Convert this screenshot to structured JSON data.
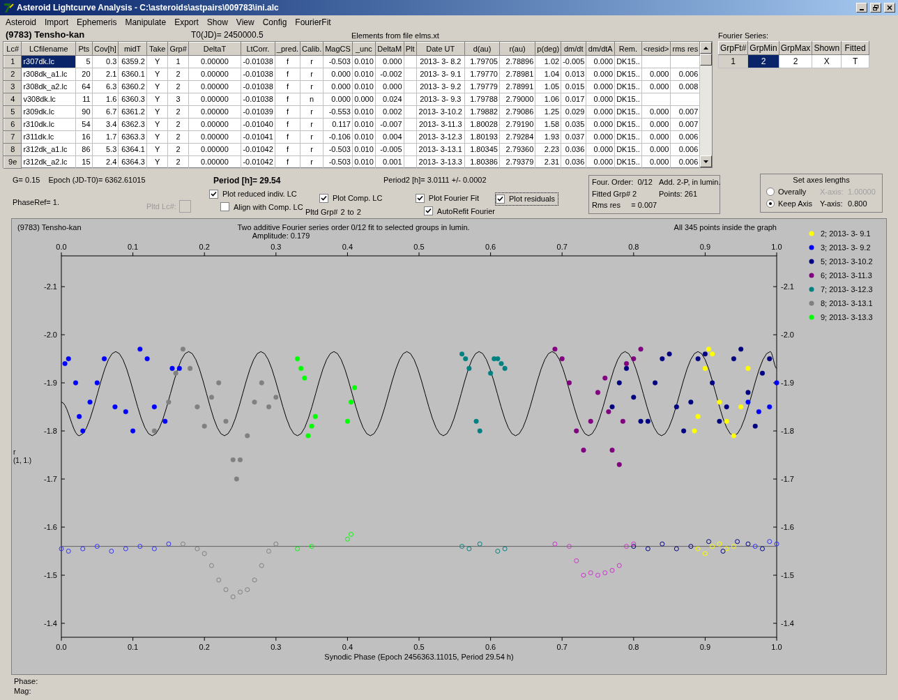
{
  "window": {
    "title": "Asteroid Lightcurve Analysis - C:\\asteroids\\astpairs\\009783\\ini.alc"
  },
  "menu": [
    "Asteroid",
    "Import",
    "Ephemeris",
    "Manipulate",
    "Export",
    "Show",
    "View",
    "Config",
    "FourierFit"
  ],
  "header": {
    "object": "(9783) Tensho-kan",
    "t0": "T0(JD)= 2450000.5",
    "elements": "Elements from file elms.xt"
  },
  "table": {
    "columns": [
      "Lc#",
      "LCfilename",
      "Pts",
      "Cov[h]",
      "midT",
      "Take",
      "Grp#",
      "DeltaT",
      "LtCorr.",
      "_pred.",
      "Calib.",
      "MagCS",
      "_unc",
      "DeltaM",
      "Plt",
      "Date UT",
      "d(au)",
      "r(au)",
      "p(deg)",
      "dm/dt",
      "dm/dtA",
      "Rem.",
      "<resid>",
      "rms res"
    ],
    "rows": [
      {
        "selected": true,
        "cells": [
          "1",
          "r307dk.lc",
          "5",
          "0.3",
          "6359.2",
          "Y",
          "1",
          "0.00000",
          "-0.01038",
          "f",
          "r",
          "-0.503",
          "0.010",
          "0.000",
          null,
          "2013- 3- 8.2",
          "1.79705",
          "2.78896",
          "1.02",
          "-0.005",
          "0.000",
          "DK15..",
          null,
          null
        ]
      },
      {
        "selected": false,
        "cells": [
          "2",
          "r308dk_a1.lc",
          "20",
          "2.1",
          "6360.1",
          "Y",
          "2",
          "0.00000",
          "-0.01038",
          "f",
          "r",
          "0.000",
          "0.010",
          "-0.002",
          null,
          "2013- 3- 9.1",
          "1.79770",
          "2.78981",
          "1.04",
          "0.013",
          "0.000",
          "DK15..",
          "0.000",
          "0.006"
        ]
      },
      {
        "selected": false,
        "cells": [
          "3",
          "r308dk_a2.lc",
          "64",
          "6.3",
          "6360.2",
          "Y",
          "2",
          "0.00000",
          "-0.01038",
          "f",
          "r",
          "0.000",
          "0.010",
          "0.000",
          null,
          "2013- 3- 9.2",
          "1.79779",
          "2.78991",
          "1.05",
          "0.015",
          "0.000",
          "DK15..",
          "0.000",
          "0.008"
        ]
      },
      {
        "selected": false,
        "cells": [
          "4",
          "v308dk.lc",
          "11",
          "1.6",
          "6360.3",
          "Y",
          "3",
          "0.00000",
          "-0.01038",
          "f",
          "n",
          "0.000",
          "0.000",
          "0.024",
          null,
          "2013- 3- 9.3",
          "1.79788",
          "2.79000",
          "1.06",
          "0.017",
          "0.000",
          "DK15..",
          null,
          null
        ]
      },
      {
        "selected": false,
        "cells": [
          "5",
          "r309dk.lc",
          "90",
          "6.7",
          "6361.2",
          "Y",
          "2",
          "0.00000",
          "-0.01039",
          "f",
          "r",
          "-0.553",
          "0.010",
          "0.002",
          null,
          "2013- 3-10.2",
          "1.79882",
          "2.79086",
          "1.25",
          "0.029",
          "0.000",
          "DK15..",
          "0.000",
          "0.007"
        ]
      },
      {
        "selected": false,
        "cells": [
          "6",
          "r310dk.lc",
          "54",
          "3.4",
          "6362.3",
          "Y",
          "2",
          "0.00000",
          "-0.01040",
          "f",
          "r",
          "0.117",
          "0.010",
          "-0.007",
          null,
          "2013- 3-11.3",
          "1.80028",
          "2.79190",
          "1.58",
          "0.035",
          "0.000",
          "DK15..",
          "0.000",
          "0.007"
        ]
      },
      {
        "selected": false,
        "cells": [
          "7",
          "r311dk.lc",
          "16",
          "1.7",
          "6363.3",
          "Y",
          "2",
          "0.00000",
          "-0.01041",
          "f",
          "r",
          "-0.106",
          "0.010",
          "0.004",
          null,
          "2013- 3-12.3",
          "1.80193",
          "2.79284",
          "1.93",
          "0.037",
          "0.000",
          "DK15..",
          "0.000",
          "0.006"
        ]
      },
      {
        "selected": false,
        "cells": [
          "8",
          "r312dk_a1.lc",
          "86",
          "5.3",
          "6364.1",
          "Y",
          "2",
          "0.00000",
          "-0.01042",
          "f",
          "r",
          "-0.503",
          "0.010",
          "-0.005",
          null,
          "2013- 3-13.1",
          "1.80345",
          "2.79360",
          "2.23",
          "0.036",
          "0.000",
          "DK15..",
          "0.000",
          "0.006"
        ]
      },
      {
        "selected": false,
        "cells": [
          "9e",
          "r312dk_a2.lc",
          "15",
          "2.4",
          "6364.3",
          "Y",
          "2",
          "0.00000",
          "-0.01042",
          "f",
          "r",
          "-0.503",
          "0.010",
          "0.001",
          null,
          "2013- 3-13.3",
          "1.80386",
          "2.79379",
          "2.31",
          "0.036",
          "0.000",
          "DK15..",
          "0.000",
          "0.006"
        ]
      }
    ]
  },
  "fourier": {
    "label": "Fourier Series:",
    "columns": [
      "GrpFt#",
      "GrpMin",
      "GrpMax",
      "Shown",
      "Fitted"
    ],
    "rows": [
      {
        "cells": [
          {
            "text": "1",
            "selected": false
          },
          {
            "text": "2",
            "selected": true
          },
          {
            "text": "2",
            "selected": false
          },
          {
            "text": "X",
            "selected": false
          },
          {
            "text": "T",
            "selected": false
          }
        ]
      }
    ]
  },
  "summary": {
    "g": "G= 0.15",
    "epoch": "Epoch (JD-T0)= 6362.61015",
    "period": "Period [h]= 29.54",
    "period2": "Period2 [h]= 3.0111 +/- 0.0002",
    "phaseref": "PhaseRef= 1."
  },
  "pltd_lc": {
    "label": "Pltd Lc#:",
    "disabled": true
  },
  "checkboxes": {
    "plot_reduced": {
      "label": "Plot reduced indiv. LC",
      "checked": true
    },
    "align": {
      "label": "Align with Comp. LC",
      "checked": false
    },
    "plot_comp": {
      "label": "Plot Comp. LC",
      "checked": true
    },
    "plot_fourier": {
      "label": "Plot Fourier Fit",
      "checked": true
    },
    "autorefit": {
      "label": "AutoRefit Fourier",
      "checked": true
    },
    "plot_residuals": {
      "label": "Plot residuals",
      "checked": true
    }
  },
  "pltd_grp": {
    "label": "Pltd Grp#",
    "from": "2",
    "to_label": "to",
    "to": "2"
  },
  "fit_info": [
    "Four. Order:  0/12",
    "Add. 2-P, in lumin.",
    "Fitted Grp# 2",
    "Points: 261",
    "Rms res     = 0.007"
  ],
  "axes": {
    "title": "Set axes lengths",
    "options": [
      {
        "label": "Overally",
        "selected": false
      },
      {
        "label": "Keep Axis",
        "selected": true
      }
    ],
    "x_label": "X-axis:",
    "x_value": "1.00000",
    "x_disabled": true,
    "y_label": "Y-axis:",
    "y_value": "0.800",
    "y_disabled": false
  },
  "plot": {
    "object": "(9783) Tensho-kan",
    "subtitle": "Two additive Fourier series order 0/12 fit to selected groups in lumin.",
    "amplitude": "Amplitude: 0.179",
    "note": "All 345 points inside the graph",
    "chart_data": {
      "type": "scatter",
      "xlabel": "Synodic Phase (Epoch 2456363.11015, Period 29.54 h)",
      "ylabel": [
        "r",
        "(1, 1.)"
      ],
      "xlim": [
        0,
        1
      ],
      "ylim": [
        -1.371,
        -2.164
      ],
      "xticks": [
        {
          "value": 0,
          "label": "0.0"
        },
        {
          "value": 0.1,
          "label": "0.1"
        },
        {
          "value": 0.2,
          "label": "0.2"
        },
        {
          "value": 0.3,
          "label": "0.3"
        },
        {
          "value": 0.4,
          "label": "0.4"
        },
        {
          "value": 0.5,
          "label": "0.5"
        },
        {
          "value": 0.6,
          "label": "0.6"
        },
        {
          "value": 0.7,
          "label": "0.7"
        },
        {
          "value": 0.8,
          "label": "0.8"
        },
        {
          "value": 0.9,
          "label": "0.9"
        },
        {
          "value": 1,
          "label": "1.0"
        }
      ],
      "yticks": [
        {
          "value": -2.1,
          "label": "-2.1"
        },
        {
          "value": -2.0,
          "label": "-2.0"
        },
        {
          "value": -1.9,
          "label": "-1.9"
        },
        {
          "value": -1.8,
          "label": "-1.8"
        },
        {
          "value": -1.7,
          "label": "-1.7"
        },
        {
          "value": -1.6,
          "label": "-1.6"
        },
        {
          "value": -1.5,
          "label": "-1.5"
        },
        {
          "value": -1.4,
          "label": "-1.4"
        }
      ],
      "ref_lines": [
        {
          "axis": "y",
          "value": -1.56,
          "color": "#606060"
        }
      ],
      "legend": true,
      "series": [
        {
          "type": "line",
          "color": "#000000",
          "x": [
            0,
            0.025,
            0.076,
            0.127,
            0.178,
            0.228,
            0.279,
            0.33,
            0.381,
            0.432,
            0.483,
            0.534,
            0.584,
            0.635,
            0.686,
            0.737,
            0.788,
            0.839,
            0.89,
            0.94,
            0.991,
            1.0
          ],
          "values": [
            -1.86,
            -1.79,
            -1.965,
            -1.79,
            -1.965,
            -1.79,
            -1.965,
            -1.79,
            -1.965,
            -1.79,
            -1.965,
            -1.79,
            -1.965,
            -1.79,
            -1.965,
            -1.79,
            -1.965,
            -1.79,
            -1.965,
            -1.79,
            -1.965,
            -1.93
          ]
        },
        {
          "name": "2; 2013- 3- 9.1",
          "color": "#ffff00",
          "marker": "circle",
          "x": [
            0.885,
            0.89,
            0.9,
            0.905,
            0.91,
            0.92,
            0.93,
            0.94,
            0.95,
            0.96
          ],
          "values": [
            -1.8,
            -1.83,
            -1.93,
            -1.97,
            -1.96,
            -1.86,
            -1.82,
            -1.79,
            -1.85,
            -1.93
          ]
        },
        {
          "name": "3; 2013- 3- 9.2",
          "color": "#0000ff",
          "marker": "circle",
          "x": [
            0.005,
            0.01,
            0.02,
            0.025,
            0.03,
            0.04,
            0.05,
            0.06,
            0.075,
            0.09,
            0.1,
            0.11,
            0.12,
            0.13,
            0.145,
            0.155,
            0.165,
            0.96,
            0.975,
            0.99,
            1.0
          ],
          "values": [
            -1.94,
            -1.95,
            -1.9,
            -1.83,
            -1.8,
            -1.86,
            -1.9,
            -1.95,
            -1.85,
            -1.84,
            -1.8,
            -1.97,
            -1.95,
            -1.85,
            -1.82,
            -1.93,
            -1.93,
            -1.86,
            -1.84,
            -1.85,
            -1.9
          ]
        },
        {
          "name": "5; 2013- 3-10.2",
          "color": "#000080",
          "marker": "circle",
          "x": [
            0.77,
            0.78,
            0.79,
            0.8,
            0.81,
            0.82,
            0.83,
            0.84,
            0.85,
            0.86,
            0.87,
            0.88,
            0.89,
            0.9,
            0.91,
            0.92,
            0.93,
            0.94,
            0.95,
            0.96,
            0.97,
            0.98,
            0.99
          ],
          "values": [
            -1.85,
            -1.9,
            -1.93,
            -1.87,
            -1.82,
            -1.82,
            -1.9,
            -1.95,
            -1.96,
            -1.85,
            -1.8,
            -1.86,
            -1.95,
            -1.96,
            -1.9,
            -1.82,
            -1.85,
            -1.95,
            -1.97,
            -1.88,
            -1.81,
            -1.92,
            -1.95
          ]
        },
        {
          "name": "6; 2013- 3-11.3",
          "color": "#800080",
          "marker": "circle",
          "x": [
            0.69,
            0.7,
            0.71,
            0.72,
            0.73,
            0.74,
            0.75,
            0.76,
            0.765,
            0.77,
            0.78,
            0.785,
            0.79,
            0.8,
            0.81
          ],
          "values": [
            -1.97,
            -1.95,
            -1.9,
            -1.8,
            -1.76,
            -1.82,
            -1.88,
            -1.91,
            -1.84,
            -1.76,
            -1.73,
            -1.82,
            -1.94,
            -1.95,
            -1.97
          ]
        },
        {
          "name": "7; 2013- 3-12.3",
          "color": "#008080",
          "marker": "circle",
          "x": [
            0.56,
            0.565,
            0.57,
            0.58,
            0.585,
            0.6,
            0.605,
            0.61,
            0.615,
            0.62
          ],
          "values": [
            -1.96,
            -1.95,
            -1.93,
            -1.82,
            -1.8,
            -1.92,
            -1.95,
            -1.95,
            -1.94,
            -1.93
          ]
        },
        {
          "name": "8; 2013- 3-13.1",
          "color": "#808080",
          "marker": "circle",
          "x": [
            0.13,
            0.15,
            0.16,
            0.17,
            0.18,
            0.19,
            0.2,
            0.21,
            0.22,
            0.23,
            0.24,
            0.245,
            0.25,
            0.26,
            0.27,
            0.28,
            0.29,
            0.3
          ],
          "values": [
            -1.8,
            -1.86,
            -1.92,
            -1.97,
            -1.93,
            -1.85,
            -1.81,
            -1.87,
            -1.9,
            -1.82,
            -1.74,
            -1.7,
            -1.74,
            -1.79,
            -1.86,
            -1.9,
            -1.85,
            -1.87
          ]
        },
        {
          "name": "9; 2013- 3-13.3",
          "color": "#00ff00",
          "marker": "circle",
          "x": [
            0.33,
            0.335,
            0.34,
            0.345,
            0.35,
            0.355,
            0.4,
            0.405,
            0.41
          ],
          "values": [
            -1.95,
            -1.93,
            -1.91,
            -1.79,
            -1.81,
            -1.83,
            -1.82,
            -1.86,
            -1.89
          ]
        },
        {
          "color": "#ffff00",
          "marker": "circle",
          "x": [
            0.89,
            0.9,
            0.91,
            0.92,
            0.93,
            0.94
          ],
          "values": [
            -1.555,
            -1.545,
            -1.56,
            -1.565,
            -1.555,
            -1.56
          ]
        },
        {
          "color": "#3030ff",
          "marker": "circle",
          "x": [
            0.0,
            0.01,
            0.03,
            0.05,
            0.07,
            0.09,
            0.11,
            0.13,
            0.15,
            0.97,
            0.99,
            1.0
          ],
          "values": [
            -1.555,
            -1.55,
            -1.555,
            -1.56,
            -1.55,
            -1.555,
            -1.56,
            -1.555,
            -1.565,
            -1.56,
            -1.57,
            -1.565
          ]
        },
        {
          "color": "#000080",
          "marker": "circle",
          "x": [
            0.8,
            0.82,
            0.84,
            0.86,
            0.88,
            0.905,
            0.925,
            0.945,
            0.96,
            0.98
          ],
          "values": [
            -1.56,
            -1.555,
            -1.565,
            -1.555,
            -1.56,
            -1.57,
            -1.55,
            -1.57,
            -1.565,
            -1.555
          ]
        },
        {
          "color": "#cc33cc",
          "marker": "circle",
          "x": [
            0.69,
            0.71,
            0.72,
            0.73,
            0.74,
            0.75,
            0.76,
            0.77,
            0.78,
            0.79,
            0.8
          ],
          "values": [
            -1.565,
            -1.56,
            -1.53,
            -1.5,
            -1.505,
            -1.5,
            -1.505,
            -1.51,
            -1.52,
            -1.56,
            -1.565
          ]
        },
        {
          "color": "#008080",
          "marker": "circle",
          "x": [
            0.56,
            0.57,
            0.585,
            0.61,
            0.62
          ],
          "values": [
            -1.56,
            -1.555,
            -1.565,
            -1.55,
            -1.555
          ]
        },
        {
          "color": "#808080",
          "marker": "circle",
          "x": [
            0.17,
            0.19,
            0.2,
            0.21,
            0.22,
            0.23,
            0.24,
            0.25,
            0.26,
            0.27,
            0.28,
            0.29,
            0.3
          ],
          "values": [
            -1.565,
            -1.555,
            -1.545,
            -1.52,
            -1.49,
            -1.47,
            -1.455,
            -1.465,
            -1.47,
            -1.49,
            -1.52,
            -1.55,
            -1.565
          ]
        },
        {
          "color": "#00ff00",
          "marker": "circle",
          "x": [
            0.33,
            0.35,
            0.4,
            0.405
          ],
          "values": [
            -1.555,
            -1.56,
            -1.575,
            -1.585
          ]
        }
      ]
    }
  },
  "status": [
    "Phase:",
    "Mag:"
  ]
}
